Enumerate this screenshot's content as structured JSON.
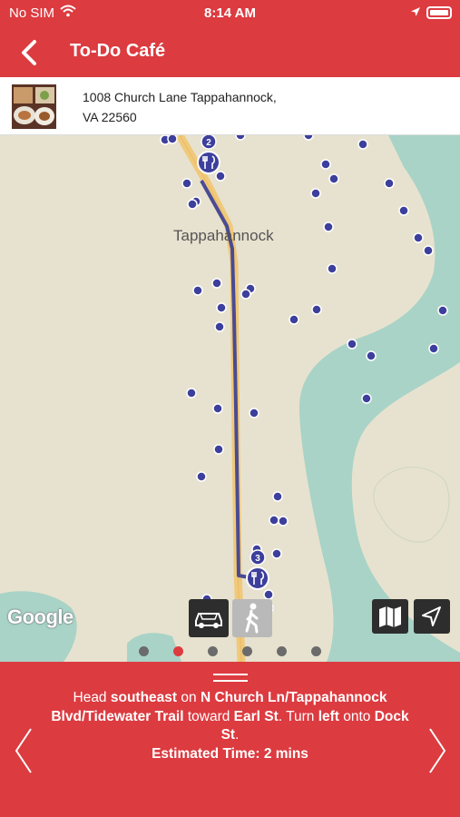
{
  "status": {
    "carrier": "No SIM",
    "time": "8:14 AM",
    "wifi_icon": "wifi-icon",
    "location_icon": "location-arrow-icon",
    "battery_icon": "battery-icon"
  },
  "nav": {
    "title": "To-Do Café",
    "back_icon": "chevron-left-icon"
  },
  "venue": {
    "address_line1": "1008 Church Lane Tappahannock,",
    "address_line2": "VA 22560"
  },
  "map": {
    "town_label": "Tappahannock",
    "attribution": "Google",
    "markers": [
      {
        "number": "2",
        "icon": "restaurant-icon"
      },
      {
        "number": "3",
        "icon": "restaurant-icon"
      }
    ],
    "colors": {
      "land": "#e7e2cf",
      "water": "#a9d3c7",
      "road": "#f0c97a",
      "route": "#4a4b93",
      "poi": "#3d3f9c"
    }
  },
  "travel_modes": [
    {
      "name": "driving",
      "icon": "car-icon",
      "selected": true
    },
    {
      "name": "walking",
      "icon": "walking-icon",
      "selected": false
    }
  ],
  "map_controls": [
    {
      "name": "map-type",
      "icon": "map-icon"
    },
    {
      "name": "locate",
      "icon": "navigation-arrow-icon"
    }
  ],
  "pagination": {
    "count": 6,
    "active_index": 1
  },
  "directions": {
    "p1": "Head ",
    "b1": "southeast",
    "p2": " on ",
    "b2": "N Church Ln/Tappahannock Blvd/Tidewater Trail",
    "p3": " toward ",
    "b3": "Earl St",
    "p4": ". Turn ",
    "b4": "left",
    "p5": " onto ",
    "b5": "Dock St",
    "p6": ".",
    "estimated_time": "Estimated Time: 2 mins"
  },
  "accent_color": "#dc3b40"
}
